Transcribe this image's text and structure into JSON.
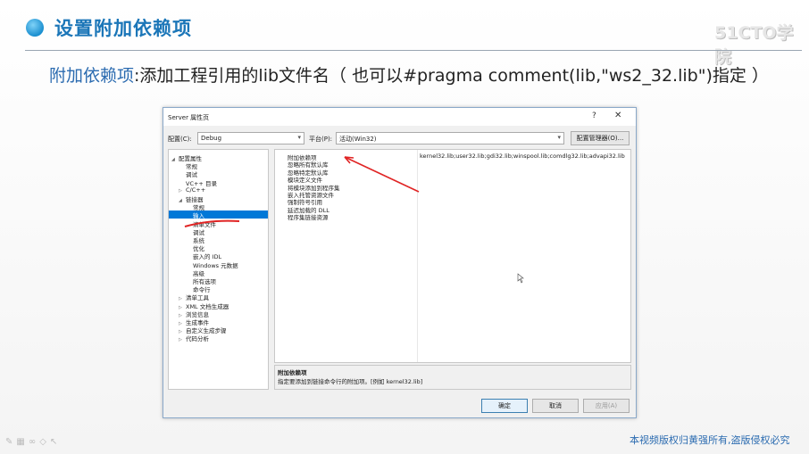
{
  "slide": {
    "title": "设置附加依赖项",
    "logo": "51CTO学院",
    "subtitle_label": "附加依赖项",
    "subtitle_sep": ":",
    "subtitle_text": "添加工程引用的lib文件名（  也可以#pragma comment(lib,\"ws2_32.lib\")指定  ）",
    "footer": "本视频版权归黄强所有,盗版侵权必究",
    "colors": {
      "accent": "#1b76b8",
      "annotation": "#e02424",
      "selection": "#0078d7"
    }
  },
  "dialog": {
    "title": "Server 属性页",
    "help": "?",
    "close": "✕",
    "config_label": "配置(C):",
    "config_value": "Debug",
    "platform_label": "平台(P):",
    "platform_value": "活动(Win32)",
    "config_manager": "配置管理器(O)...",
    "tree": [
      {
        "label": "配置属性",
        "toggle": "◢",
        "indent": 0
      },
      {
        "label": "常规",
        "toggle": "",
        "indent": 1
      },
      {
        "label": "调试",
        "toggle": "",
        "indent": 1
      },
      {
        "label": "VC++ 目录",
        "toggle": "",
        "indent": 1
      },
      {
        "label": "C/C++",
        "toggle": "▷",
        "indent": 1
      },
      {
        "label": "链接器",
        "toggle": "◢",
        "indent": 1
      },
      {
        "label": "常规",
        "toggle": "",
        "indent": 2
      },
      {
        "label": "输入",
        "toggle": "",
        "indent": 2,
        "selected": true
      },
      {
        "label": "清单文件",
        "toggle": "",
        "indent": 2
      },
      {
        "label": "调试",
        "toggle": "",
        "indent": 2
      },
      {
        "label": "系统",
        "toggle": "",
        "indent": 2
      },
      {
        "label": "优化",
        "toggle": "",
        "indent": 2
      },
      {
        "label": "嵌入的 IDL",
        "toggle": "",
        "indent": 2
      },
      {
        "label": "Windows 元数据",
        "toggle": "",
        "indent": 2
      },
      {
        "label": "高级",
        "toggle": "",
        "indent": 2
      },
      {
        "label": "所有选项",
        "toggle": "",
        "indent": 2
      },
      {
        "label": "命令行",
        "toggle": "",
        "indent": 2
      },
      {
        "label": "清单工具",
        "toggle": "▷",
        "indent": 1
      },
      {
        "label": "XML 文档生成器",
        "toggle": "▷",
        "indent": 1
      },
      {
        "label": "浏览信息",
        "toggle": "▷",
        "indent": 1
      },
      {
        "label": "生成事件",
        "toggle": "▷",
        "indent": 1
      },
      {
        "label": "自定义生成步骤",
        "toggle": "▷",
        "indent": 1
      },
      {
        "label": "代码分析",
        "toggle": "▷",
        "indent": 1
      }
    ],
    "properties": [
      {
        "name": "附加依赖项",
        "value": "kernel32.lib;user32.lib;gdi32.lib;winspool.lib;comdlg32.lib;advapi32.lib"
      },
      {
        "name": "忽略所有默认库",
        "value": ""
      },
      {
        "name": "忽略特定默认库",
        "value": ""
      },
      {
        "name": "模块定义文件",
        "value": ""
      },
      {
        "name": "将模块添加到程序集",
        "value": ""
      },
      {
        "name": "嵌入托管资源文件",
        "value": ""
      },
      {
        "name": "强制符号引用",
        "value": ""
      },
      {
        "name": "延迟加载的 DLL",
        "value": ""
      },
      {
        "name": "程序集链接资源",
        "value": ""
      }
    ],
    "desc_title": "附加依赖项",
    "desc_text": "指定要添加到链接命令行的附加项。[例如 kernel32.lib]",
    "ok": "确定",
    "cancel": "取消",
    "apply": "应用(A)"
  }
}
